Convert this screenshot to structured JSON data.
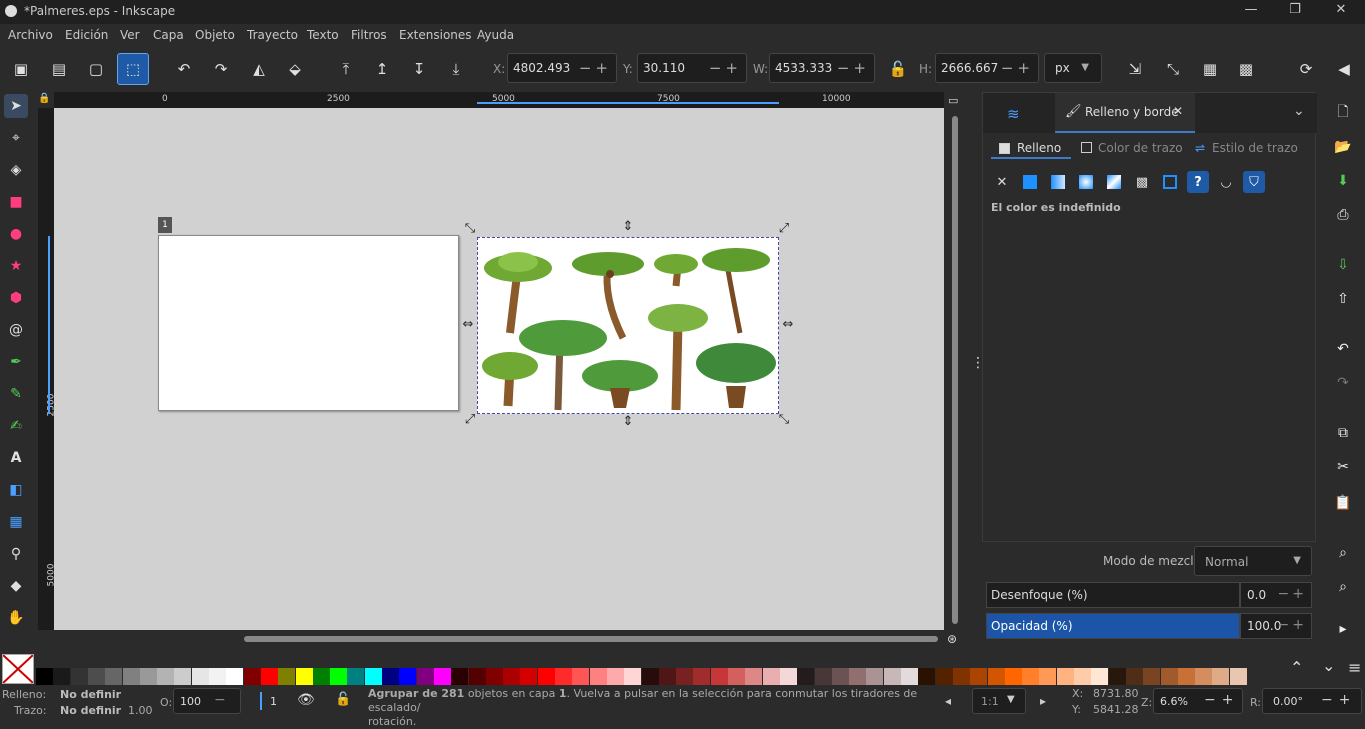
{
  "window": {
    "title": "*Palmeres.eps - Inkscape",
    "minimize": "—",
    "restore": "❐",
    "close": "✕"
  },
  "menu": [
    "Archivo",
    "Edición",
    "Ver",
    "Capa",
    "Objeto",
    "Trayecto",
    "Texto",
    "Filtros",
    "Extensiones",
    "Ayuda"
  ],
  "coords": {
    "x_label": "X:",
    "x": "4802.493",
    "y_label": "Y:",
    "y": "30.110",
    "w_label": "W:",
    "w": "4533.333",
    "h_label": "H:",
    "h": "2666.667",
    "unit": "px"
  },
  "rulers": {
    "h_ticks": [
      "0",
      "2500",
      "5000",
      "7500",
      "10000"
    ],
    "v_ticks": [
      "2500",
      "5000"
    ]
  },
  "page_number": "1",
  "fill_stroke": {
    "tab_label": "Relleno y borde",
    "sub_tabs": [
      "Relleno",
      "Color de trazo",
      "Estilo de trazo"
    ],
    "paint_status": "El color es indefinido",
    "blend_label": "Modo de mezcla:",
    "blend_value": "Normal",
    "blur_label": "Desenfoque (%)",
    "blur_value": "0.0",
    "opacity_label": "Opacidad (%)",
    "opacity_value": "100.0"
  },
  "status": {
    "fill_label": "Relleno:",
    "fill_value": "No definir",
    "stroke_label": "Trazo:",
    "stroke_value": "No definir",
    "stroke_width": "1.00",
    "opacity_label": "O:",
    "opacity_value": "100",
    "layer": "1",
    "message_1": "Agrupar de ",
    "message_count": "281",
    "message_2": " objetos en capa ",
    "message_layer": "1",
    "message_3": ". Vuelva a pulsar en la selección para conmutar los tiradores de escalado/",
    "message_4": "rotación.",
    "zoom_ratio": "1:1",
    "cursor_x_label": "X:",
    "cursor_x": "8731.80",
    "cursor_y_label": "Y:",
    "cursor_y": "5841.28",
    "zoom_label": "Z:",
    "zoom": "6.6%",
    "rotation_label": "R:",
    "rotation": "0.00°"
  },
  "colors": {
    "accent": "#1f5aa6",
    "opacity_bar": "#1c55a8",
    "palette": [
      "#000000",
      "#1a1a1a",
      "#333333",
      "#4d4d4d",
      "#666666",
      "#808080",
      "#999999",
      "#b3b3b3",
      "#cccccc",
      "#e6e6e6",
      "#f2f2f2",
      "#ffffff",
      "#800000",
      "#ff0000",
      "#808000",
      "#ffff00",
      "#008000",
      "#00ff00",
      "#008080",
      "#00ffff",
      "#000080",
      "#0000ff",
      "#800080",
      "#ff00ff",
      "#2b0000",
      "#550000",
      "#800000",
      "#aa0000",
      "#d40000",
      "#ff0000",
      "#ff2a2a",
      "#ff5555",
      "#ff8080",
      "#ffaaaa",
      "#ffd5d5",
      "#280b0b",
      "#501616",
      "#782121",
      "#a02c2c",
      "#c83737",
      "#d35f5f",
      "#de8787",
      "#e9afaf",
      "#f4d7d7",
      "#241c1c",
      "#483737",
      "#6c5353",
      "#916f6f",
      "#ac9393",
      "#c8b7b7",
      "#e3dbdb",
      "#2b1100",
      "#552200",
      "#803300",
      "#aa4400",
      "#d45500",
      "#ff6600",
      "#ff7f2a",
      "#ff9955",
      "#ffb380",
      "#ffccaa",
      "#ffe6d5",
      "#28170b",
      "#502d16",
      "#784421",
      "#a05a2c",
      "#c87137",
      "#d38d5f",
      "#deaa87",
      "#e9c6af"
    ]
  }
}
